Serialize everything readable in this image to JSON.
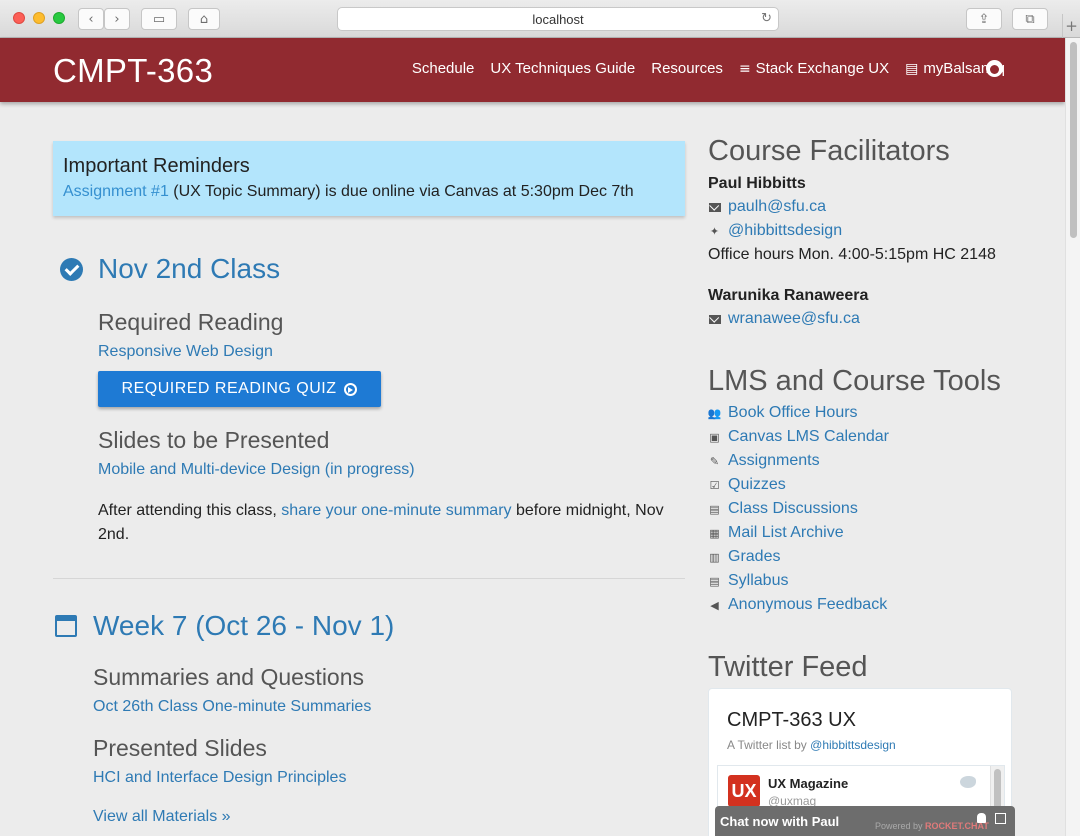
{
  "browser": {
    "url": "localhost",
    "back_icon": "chevron-left",
    "forward_icon": "chevron-right"
  },
  "navbar": {
    "brand": "CMPT-363",
    "links": [
      "Schedule",
      "UX Techniques Guide",
      "Resources",
      "Stack Exchange UX",
      "myBalsamiq"
    ],
    "color": "#912a30"
  },
  "reminder": {
    "title": "Important Reminders",
    "link_text": "Assignment #1",
    "text": " (UX Topic Summary) is due online via Canvas at 5:30pm Dec 7th"
  },
  "nov2": {
    "title": "Nov 2nd Class",
    "required_reading_heading": "Required Reading",
    "reading_link": "Responsive Web Design",
    "quiz_button": "REQUIRED READING QUIZ",
    "slides_heading": "Slides to be Presented",
    "slides_link": "Mobile and Multi-device Design (in progress)",
    "after_prefix": "After attending this class, ",
    "after_link": "share your one-minute summary",
    "after_suffix": " before midnight, Nov 2nd."
  },
  "week7": {
    "title": "Week 7 (Oct 26 - Nov 1)",
    "summaries_heading": "Summaries and Questions",
    "summaries_link": "Oct 26th Class One-minute Summaries",
    "slides_heading": "Presented Slides",
    "slides_link": "HCI and Interface Design Principles",
    "view_all": "View all Materials",
    "view_all_glyph": "»"
  },
  "sidebar": {
    "facilitators_heading": "Course Facilitators",
    "facilitator1": {
      "name": "Paul Hibbitts",
      "email": "paulh@sfu.ca",
      "twitter": "@hibbittsdesign",
      "office_hours": "Office hours Mon. 4:00-5:15pm HC 2148"
    },
    "facilitator2": {
      "name": "Warunika Ranaweera",
      "email": "wranawee@sfu.ca"
    },
    "lms_heading": "LMS and Course Tools",
    "lms_items": [
      "Book Office Hours",
      "Canvas LMS Calendar",
      "Assignments",
      "Quizzes",
      "Class Discussions",
      "Mail List Archive",
      "Grades",
      "Syllabus",
      "Anonymous Feedback"
    ],
    "twitter_heading": "Twitter Feed"
  },
  "twitter": {
    "title": "CMPT-363 UX",
    "sub_prefix": "A Twitter list by ",
    "sub_link": "@hibbittsdesign",
    "tweet_avatar": "UX",
    "tweet_name": "UX Magazine",
    "tweet_handle": "@uxmag"
  },
  "chat": {
    "label": "Chat now with Paul",
    "powered": "Powered by",
    "brand": "ROCKET.CHAT"
  }
}
